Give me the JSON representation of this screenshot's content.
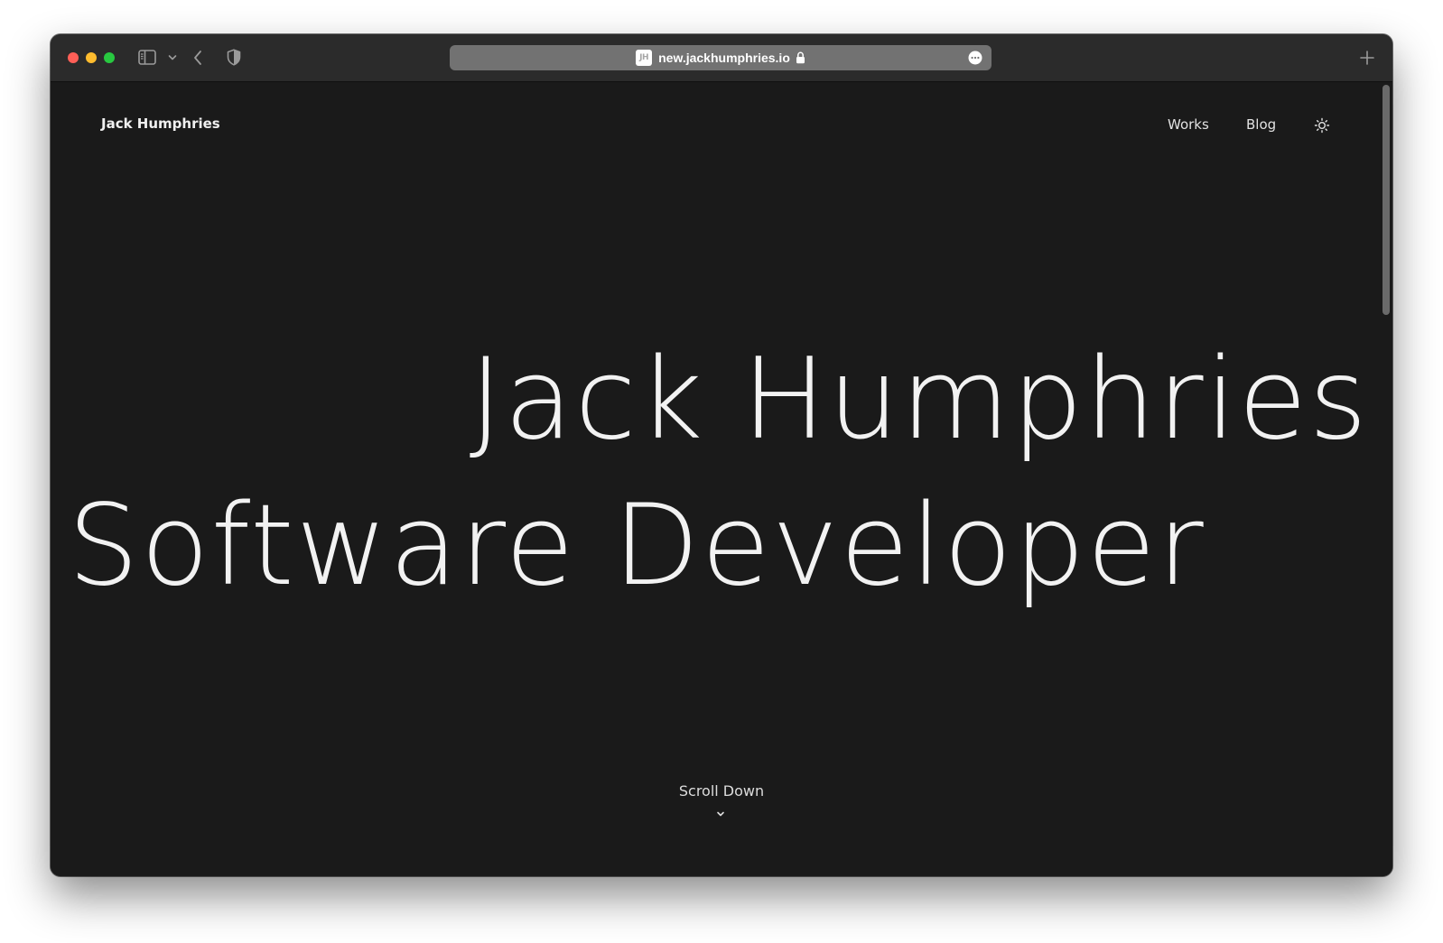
{
  "browser": {
    "url": "new.jackhumphries.io",
    "favicon_text": "JH",
    "icons": {
      "sidebar": "sidebar-icon",
      "sidebar_menu": "chevron-down-icon",
      "back": "chevron-left-icon",
      "privacy": "shield-icon",
      "lock": "lock-icon",
      "page_menu": "more-icon",
      "new_tab": "plus-icon"
    },
    "colors": {
      "close": "#ff5f57",
      "minimize": "#febc2e",
      "maximize": "#28c840"
    }
  },
  "site": {
    "logo": "Jack Humphries",
    "nav": {
      "works": "Works",
      "blog": "Blog",
      "theme_icon": "sun-icon"
    },
    "hero": {
      "name": "Jack Humphries",
      "role": "Software Developer"
    },
    "scroll_label": "Scroll Down",
    "scroll_icon": "chevron-down-icon",
    "background_color": "#1a1a1a",
    "text_color": "#f2f2f2"
  }
}
